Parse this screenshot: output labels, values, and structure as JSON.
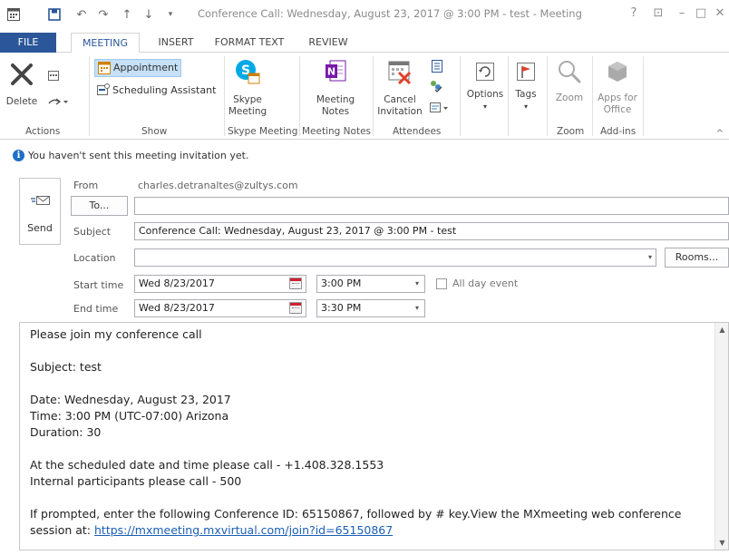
{
  "window": {
    "title": "Conference Call: Wednesday, August 23, 2017 @ 3:00 PM - test - Meeting",
    "help": "?",
    "restore": "⊡",
    "minimize": "–",
    "maximize": "□",
    "close": "✕"
  },
  "tabs": [
    "FILE",
    "MEETING",
    "INSERT",
    "FORMAT TEXT",
    "REVIEW"
  ],
  "ribbon": {
    "actions": {
      "label": "Actions",
      "delete_label": "Delete"
    },
    "show": {
      "label": "Show",
      "appointment": "Appointment",
      "scheduling": "Scheduling Assistant"
    },
    "skype": {
      "label": "Skype Meeting",
      "button_line1": "Skype",
      "button_line2": "Meeting"
    },
    "notes": {
      "label": "Meeting Notes",
      "button_line1": "Meeting",
      "button_line2": "Notes"
    },
    "attendees": {
      "label": "Attendees",
      "cancel_line1": "Cancel",
      "cancel_line2": "Invitation"
    },
    "options": {
      "label": "Options"
    },
    "tags": {
      "label": "Tags"
    },
    "zoom": {
      "label": "Zoom",
      "button": "Zoom"
    },
    "addins": {
      "label": "Add-ins",
      "button_line1": "Apps for",
      "button_line2": "Office"
    }
  },
  "info_message": "You haven't sent this meeting invitation yet.",
  "form": {
    "send_label": "Send",
    "from_label": "From",
    "from_value": "charles.detranaltes@zultys.com",
    "to_button": "To...",
    "to_value": "",
    "subject_label": "Subject",
    "subject_value": "Conference Call: Wednesday, August 23, 2017 @ 3:00 PM - test",
    "location_label": "Location",
    "location_value": "",
    "rooms_button": "Rooms...",
    "start_label": "Start time",
    "start_date": "Wed 8/23/2017",
    "start_time": "3:00 PM",
    "allday_label": "All day event",
    "end_label": "End time",
    "end_date": "Wed 8/23/2017",
    "end_time": "3:30 PM"
  },
  "body": {
    "line1": "Please join my conference call",
    "line2": "Subject: test",
    "line3": "Date: Wednesday, August 23, 2017",
    "line4": "Time: 3:00 PM (UTC-07:00) Arizona",
    "line5": "Duration: 30",
    "line6": "At the scheduled date and time please call - +1.408.328.1553",
    "line7": "Internal participants please call - 500",
    "line8": "If prompted, enter the following Conference ID: 65150867, followed by # key.View the MXmeeting web conference",
    "line9_prefix": "session at: ",
    "link": "https://mxmeeting.mxvirtual.com/join?id=65150867"
  },
  "colors": {
    "file_tab": "#2b579a",
    "accent": "#2b579a",
    "selected_button": "#c5e0f7",
    "link": "#1a5fb4",
    "info_icon": "#1f6fc5"
  }
}
